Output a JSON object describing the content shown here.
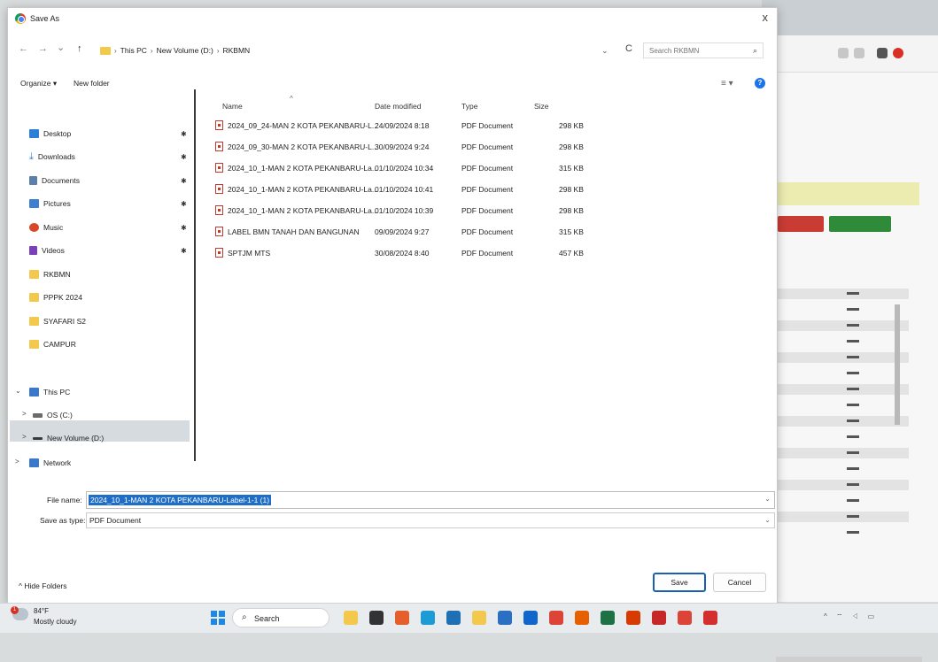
{
  "dialog": {
    "title": "Save As",
    "close_glyph": "x"
  },
  "nav": {
    "back": "←",
    "forward": "→",
    "recent": "⌄",
    "up": "↑",
    "breadcrumbs": [
      "This PC",
      "New Volume (D:)",
      "RKBMN"
    ],
    "dropdown": "⌄",
    "refresh": "C",
    "search_placeholder": "Search RKBMN"
  },
  "commands": {
    "organize": "Organize ▾",
    "new_folder": "New folder",
    "view": "≡ ▾",
    "help": "?"
  },
  "sidebar": {
    "items": [
      {
        "label": "Desktop",
        "icon": "desktop-icon",
        "color": "#2b7fd6",
        "pinned": true
      },
      {
        "label": "Downloads",
        "icon": "download-icon",
        "color": "#2b7fd6",
        "pinned": true
      },
      {
        "label": "Documents",
        "icon": "documents-icon",
        "color": "#5a7fa8",
        "pinned": true
      },
      {
        "label": "Pictures",
        "icon": "pictures-icon",
        "color": "#3f7fd0",
        "pinned": true
      },
      {
        "label": "Music",
        "icon": "music-icon",
        "color": "#d9472b",
        "pinned": true
      },
      {
        "label": "Videos",
        "icon": "videos-icon",
        "color": "#7b3fb8",
        "pinned": true
      },
      {
        "label": "RKBMN",
        "icon": "folder-icon",
        "color": "#f2c94c"
      },
      {
        "label": "PPPK 2024",
        "icon": "folder-icon",
        "color": "#f2c94c"
      },
      {
        "label": "SYAFARI S2",
        "icon": "folder-icon",
        "color": "#f2c94c"
      },
      {
        "label": "CAMPUR",
        "icon": "folder-icon",
        "color": "#f2c94c"
      }
    ],
    "tree": [
      {
        "label": "This PC",
        "chevron": "⌄",
        "icon": "pc-icon"
      },
      {
        "label": "OS (C:)",
        "chevron": ">",
        "icon": "drive-icon"
      },
      {
        "label": "New Volume (D:)",
        "chevron": ">",
        "icon": "drive-icon",
        "selected": true
      },
      {
        "label": "Network",
        "chevron": ">",
        "icon": "network-icon"
      }
    ],
    "pin_glyph": "✱"
  },
  "columns": {
    "name": "Name",
    "date": "Date modified",
    "type": "Type",
    "size": "Size",
    "sort_glyph": "^"
  },
  "files": [
    {
      "name": "2024_09_24-MAN 2 KOTA PEKANBARU-L...",
      "date": "24/09/2024 8:18",
      "type": "PDF Document",
      "size": "298 KB"
    },
    {
      "name": "2024_09_30-MAN 2 KOTA PEKANBARU-L...",
      "date": "30/09/2024 9:24",
      "type": "PDF Document",
      "size": "298 KB"
    },
    {
      "name": "2024_10_1-MAN 2 KOTA PEKANBARU-La...",
      "date": "01/10/2024 10:34",
      "type": "PDF Document",
      "size": "315 KB"
    },
    {
      "name": "2024_10_1-MAN 2 KOTA PEKANBARU-La...",
      "date": "01/10/2024 10:41",
      "type": "PDF Document",
      "size": "298 KB"
    },
    {
      "name": "2024_10_1-MAN 2 KOTA PEKANBARU-La...",
      "date": "01/10/2024 10:39",
      "type": "PDF Document",
      "size": "298 KB"
    },
    {
      "name": "LABEL BMN TANAH DAN BANGUNAN",
      "date": "09/09/2024 9:27",
      "type": "PDF Document",
      "size": "315 KB"
    },
    {
      "name": "SPTJM MTS",
      "date": "30/08/2024 8:40",
      "type": "PDF Document",
      "size": "457 KB"
    }
  ],
  "form": {
    "file_name_label": "File name:",
    "file_name_value": "2024_10_1-MAN 2 KOTA PEKANBARU-Label-1-1 (1)",
    "type_label": "Save as type:",
    "type_value": "PDF Document",
    "dd_glyph": "⌄"
  },
  "footer": {
    "hide_folders": "^ Hide Folders",
    "save": "Save",
    "cancel": "Cancel"
  },
  "taskbar": {
    "temperature": "84°F",
    "condition": "Mostly cloudy",
    "search_label": "Search",
    "search_glyph": "⌕",
    "apps": [
      {
        "icon": "file-explorer-icon",
        "color": "#f2c94c"
      },
      {
        "icon": "task-view-icon",
        "color": "#333333"
      },
      {
        "icon": "copilot-icon",
        "color": "#e45f2b"
      },
      {
        "icon": "edge-icon",
        "color": "#1d9bd7"
      },
      {
        "icon": "store-icon",
        "color": "#1f6fb5"
      },
      {
        "icon": "folder-app-icon",
        "color": "#f2c94c"
      },
      {
        "icon": "photos-icon",
        "color": "#2b6fc2"
      },
      {
        "icon": "outlook-icon",
        "color": "#1166cc"
      },
      {
        "icon": "chrome-icon",
        "color": "#db4437"
      },
      {
        "icon": "firefox-icon",
        "color": "#e66000"
      },
      {
        "icon": "excel-icon",
        "color": "#1e7145"
      },
      {
        "icon": "office-icon",
        "color": "#d83b01"
      },
      {
        "icon": "app-red-icon",
        "color": "#c62828"
      },
      {
        "icon": "chrome-alt-icon",
        "color": "#db4437"
      },
      {
        "icon": "pdf-app-icon",
        "color": "#d32f2f"
      }
    ],
    "tray": "^ ⌔ ◁ ▭"
  }
}
